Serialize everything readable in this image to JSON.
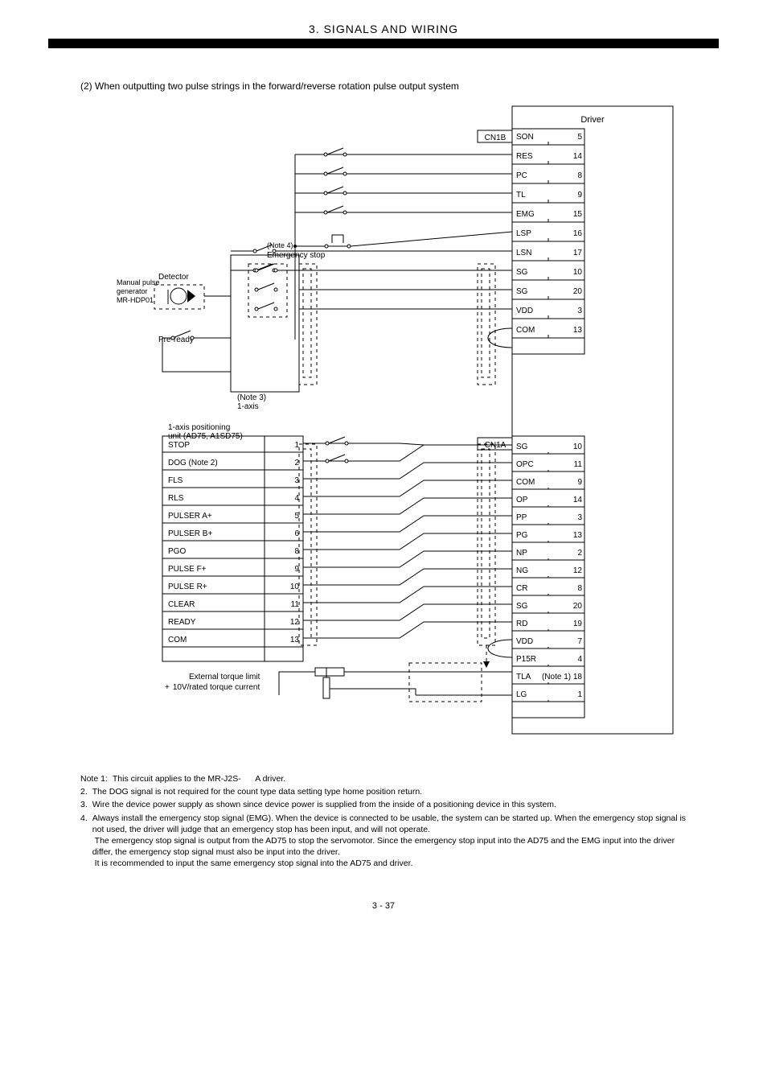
{
  "header": {
    "title": "3. SIGNALS AND WIRING",
    "subtitle": "(2) When outputting two pulse strings in the forward/reverse rotation pulse output system"
  },
  "diagram": {
    "driver": "Driver",
    "cn1a": "CN1A",
    "detector": "Detector",
    "manual_pulse_gen": "Manual pulse\ngenerator\nMR-HDP01",
    "preready": "Pre-ready",
    "estop_note_ref": "(Note 4)",
    "estop_label": "Emergency stop",
    "oneaxis_label": "(Note 3)\n1-axis",
    "pos_left_block": "1-axis positioning\nunit (AD75, A1SD75)",
    "left_rows": {
      "stop": "STOP",
      "dog": "DOG (Note 2)",
      "fls": "FLS",
      "rls": "RLS",
      "pulser_a": "PULSER A+",
      "pulser_b": "PULSER B+",
      "pgo": "PGO",
      "pulse_f": "PULSE F+",
      "pulse_r": "PULSE R+",
      "clear": "CLEAR",
      "ready": "READY",
      "com": "COM"
    },
    "pins_left": {
      "stop": "1",
      "dog": "2",
      "fls": "3",
      "rls": "4",
      "pulser_a": "5",
      "pulser_b": "6",
      "pgo": "8",
      "pulse_f": "9",
      "pulse_r": "10",
      "clear": "11",
      "ready": "12",
      "com": "13"
    },
    "cn1b": "CN1B",
    "right_rows": [
      {
        "name": "SON",
        "pin": "5"
      },
      {
        "name": "RES",
        "pin": "14"
      },
      {
        "name": "PC",
        "pin": "8"
      },
      {
        "name": "TL",
        "pin": "9"
      },
      {
        "name": "EMG",
        "pin": "15"
      },
      {
        "name": "LSP",
        "pin": "16"
      },
      {
        "name": "LSN",
        "pin": "17"
      },
      {
        "name": "SG",
        "pin": "10"
      },
      {
        "name": "SG",
        "pin": "20"
      },
      {
        "name": "VDD",
        "pin": "3"
      },
      {
        "name": "COM",
        "pin": "13"
      }
    ],
    "cn1a_rows": [
      {
        "name": "SG",
        "pin": "10"
      },
      {
        "name": "OPC",
        "pin": "11"
      },
      {
        "name": "COM",
        "pin": "9"
      },
      {
        "name": "OP",
        "pin": "14"
      },
      {
        "name": "PP",
        "pin": "3"
      },
      {
        "name": "PG",
        "pin": "13"
      },
      {
        "name": "NP",
        "pin": "2"
      },
      {
        "name": "NG",
        "pin": "12"
      },
      {
        "name": "CR",
        "pin": "8"
      },
      {
        "name": "SG",
        "pin": "20"
      },
      {
        "name": "RD",
        "pin": "19"
      },
      {
        "name": "VDD",
        "pin": "7"
      },
      {
        "name": "P15R",
        "pin": "4"
      },
      {
        "name": "TLA",
        "pin": "(Note 1) 18"
      },
      {
        "name": "LG",
        "pin": "1"
      }
    ],
    "ext_torque": "External torque limit",
    "ext_torque_source": "10V/rated torque current"
  },
  "notes": {
    "note1": "Note 1:  This circuit applies to the MR-J2S-      A driver.",
    "note2": "2.  The DOG signal is not required for the count type data setting type home position return.",
    "note3": "3.  Wire the device power supply as shown since device power is supplied from the inside of a\n     positioning device in this system.",
    "note4": "4.  Always install the emergency stop signal (EMG). When the device is connected to be usable, the\n     system can be started up. When the emergency stop signal is not used, the driver will judge that\n     an emergency stop has been input, and will not operate.\n      The emergency stop signal is output from the AD75 to stop the servomotor. Since the emergency\n     stop input into the AD75 and the EMG input into the driver differ, the emergency stop signal must\n     also be input into the driver.\n      It is recommended to input the same emergency stop signal into the AD75 and driver."
  },
  "page": "3 - 37"
}
